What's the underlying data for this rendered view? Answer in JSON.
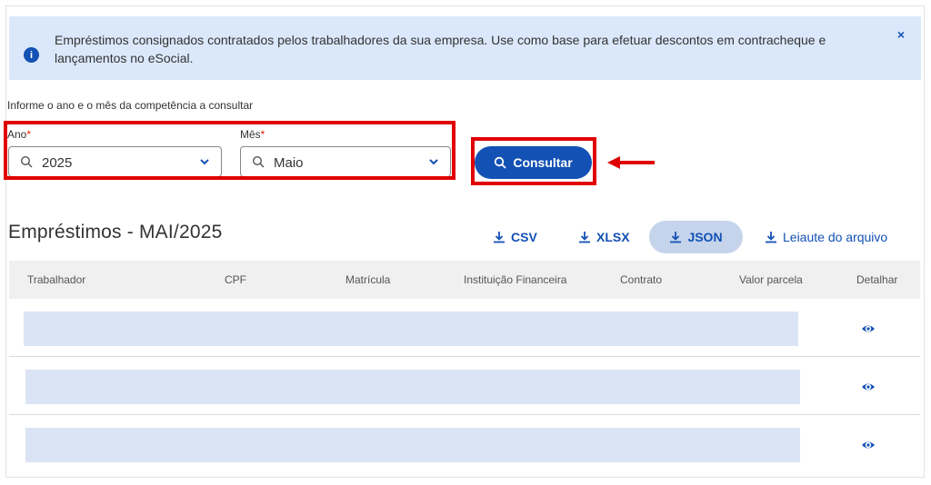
{
  "alert": {
    "text": "Empréstimos consignados contratados pelos trabalhadores da sua empresa. Use como base para efetuar descontos em contracheque e lançamentos no eSocial.",
    "info_icon": "info-icon",
    "close_icon": "close-icon",
    "close_glyph": "×"
  },
  "filters": {
    "hint": "Informe o ano e o mês da competência a consultar",
    "ano": {
      "label": "Ano",
      "required_mark": "*",
      "value": "2025"
    },
    "mes": {
      "label": "Mês",
      "required_mark": "*",
      "value": "Maio"
    }
  },
  "search_button": {
    "label": "Consultar",
    "icon": "search-icon"
  },
  "results": {
    "title": "Empréstimos - MAI/2025",
    "downloads": [
      {
        "label": "CSV",
        "icon": "download-icon"
      },
      {
        "label": "XLSX",
        "icon": "download-icon"
      },
      {
        "label": "JSON",
        "icon": "download-icon",
        "active": true
      },
      {
        "label": "Leiaute do arquivo",
        "icon": "download-icon"
      }
    ],
    "columns": [
      "Trabalhador",
      "CPF",
      "Matrícula",
      "Instituição Financeira",
      "Contrato",
      "Valor parcela",
      "Detalhar"
    ],
    "rows": [
      {
        "detail_icon": "eye-icon"
      },
      {
        "detail_icon": "eye-icon"
      },
      {
        "detail_icon": "eye-icon"
      }
    ]
  },
  "colors": {
    "primary": "#1351b4",
    "alert_bg": "#dbe8fb",
    "highlight": "#e00000",
    "placeholder_bar": "#dbe4f4"
  }
}
